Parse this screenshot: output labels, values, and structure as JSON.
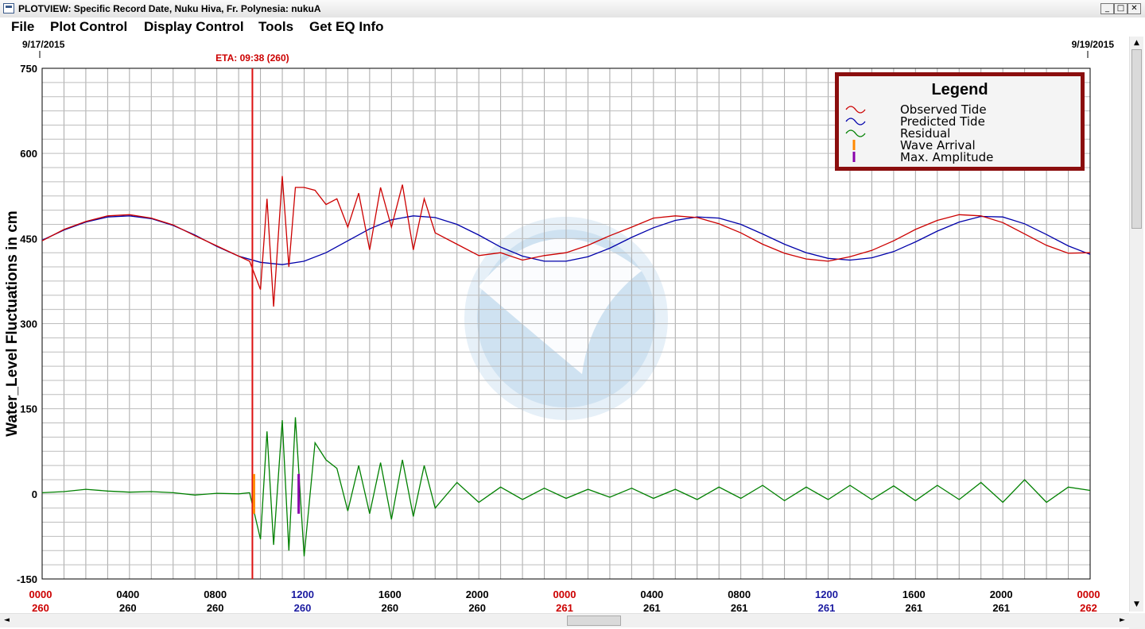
{
  "window": {
    "title": "PLOTVIEW: Specific Record Date, Nuku Hiva, Fr. Polynesia: nukuA",
    "minimize_glyph": "_",
    "maximize_glyph": "□",
    "close_glyph": "✕",
    "icon": "app-icon"
  },
  "menu": {
    "items": [
      "File",
      "Plot Control",
      "Display Control",
      "Tools",
      "Get EQ Info"
    ]
  },
  "scrollbars": {
    "up_glyph": "▲",
    "down_glyph": "▼",
    "left_glyph": "◄",
    "right_glyph": "►"
  },
  "chart_data": {
    "type": "line",
    "date_start": "9/17/2015",
    "date_end": "9/19/2015",
    "ylabel": "Water_Level Fluctuations in cm",
    "ylim": [
      -150,
      750
    ],
    "yticks": [
      750,
      600,
      450,
      300,
      150,
      0,
      -150
    ],
    "xlim_hours": [
      0,
      48
    ],
    "eta_label": "ETA: 09:38 (260)",
    "eta_hour": 9.63,
    "grid": true,
    "background_emblem": "noaa-seal-watermark",
    "x_tick_hours": [
      0,
      4,
      8,
      12,
      16,
      20,
      24,
      28,
      32,
      36,
      40,
      44,
      48
    ],
    "x_tick_times": [
      "0000",
      "0400",
      "0800",
      "1200",
      "1600",
      "2000",
      "0000",
      "0400",
      "0800",
      "1200",
      "1600",
      "2000",
      "0000"
    ],
    "x_tick_days": [
      "260",
      "260",
      "260",
      "260",
      "260",
      "260",
      "261",
      "261",
      "261",
      "261",
      "261",
      "261",
      "262"
    ],
    "x_tick_colors": [
      "#cc0000",
      "#000000",
      "#000000",
      "#1a1aa0",
      "#000000",
      "#000000",
      "#cc0000",
      "#000000",
      "#000000",
      "#1a1aa0",
      "#000000",
      "#000000",
      "#cc0000"
    ],
    "legend": {
      "title": "Legend",
      "position": "top-right",
      "entries": [
        {
          "label": "Observed Tide",
          "color": "#cc0000",
          "symbol": "wave"
        },
        {
          "label": "Predicted Tide",
          "color": "#0000aa",
          "symbol": "wave"
        },
        {
          "label": "Residual",
          "color": "#008000",
          "symbol": "wave"
        },
        {
          "label": "Wave Arrival",
          "color": "#ff8800",
          "symbol": "bar"
        },
        {
          "label": "Max. Amplitude",
          "color": "#8800aa",
          "symbol": "bar"
        }
      ]
    },
    "series": [
      {
        "name": "Predicted Tide",
        "color": "#0000aa",
        "x": [
          0,
          1,
          2,
          3,
          4,
          5,
          6,
          7,
          8,
          9,
          10,
          11,
          12,
          13,
          14,
          15,
          16,
          17,
          18,
          19,
          20,
          21,
          22,
          23,
          24,
          25,
          26,
          27,
          28,
          29,
          30,
          31,
          32,
          33,
          34,
          35,
          36,
          37,
          38,
          39,
          40,
          41,
          42,
          43,
          44,
          45,
          46,
          47,
          48
        ],
        "values": [
          447,
          465,
          479,
          488,
          490,
          485,
          473,
          456,
          436,
          419,
          408,
          404,
          410,
          425,
          446,
          467,
          483,
          490,
          487,
          475,
          456,
          435,
          419,
          410,
          410,
          418,
          433,
          452,
          469,
          482,
          488,
          486,
          475,
          458,
          440,
          425,
          415,
          412,
          416,
          427,
          444,
          463,
          479,
          489,
          488,
          476,
          457,
          437,
          422
        ]
      },
      {
        "name": "Observed Tide",
        "color": "#cc0000",
        "x": [
          0,
          1,
          2,
          3,
          4,
          5,
          6,
          7,
          8,
          9,
          9.5,
          10,
          10.3,
          10.6,
          11,
          11.3,
          11.6,
          12,
          12.5,
          13,
          13.5,
          14,
          14.5,
          15,
          15.5,
          16,
          16.5,
          17,
          17.5,
          18,
          19,
          20,
          21,
          22,
          23,
          24,
          25,
          26,
          27,
          28,
          29,
          30,
          31,
          32,
          33,
          34,
          35,
          36,
          37,
          38,
          39,
          40,
          41,
          42,
          43,
          44,
          45,
          46,
          47,
          48
        ],
        "values": [
          446,
          466,
          480,
          490,
          492,
          486,
          474,
          455,
          437,
          419,
          410,
          360,
          520,
          330,
          560,
          400,
          540,
          540,
          535,
          510,
          520,
          470,
          530,
          430,
          540,
          470,
          545,
          430,
          520,
          460,
          440,
          420,
          425,
          412,
          420,
          425,
          438,
          455,
          470,
          486,
          490,
          487,
          476,
          460,
          440,
          424,
          414,
          410,
          418,
          429,
          446,
          466,
          482,
          492,
          490,
          478,
          458,
          438,
          424,
          425
        ]
      },
      {
        "name": "Residual",
        "color": "#008000",
        "x": [
          0,
          1,
          2,
          3,
          4,
          5,
          6,
          7,
          8,
          9,
          9.5,
          10,
          10.3,
          10.6,
          11,
          11.3,
          11.6,
          12,
          12.5,
          13,
          13.5,
          14,
          14.5,
          15,
          15.5,
          16,
          16.5,
          17,
          17.5,
          18,
          19,
          20,
          21,
          22,
          23,
          24,
          25,
          26,
          27,
          28,
          29,
          30,
          31,
          32,
          33,
          34,
          35,
          36,
          37,
          38,
          39,
          40,
          41,
          42,
          43,
          44,
          45,
          46,
          47,
          48
        ],
        "values": [
          2,
          4,
          8,
          5,
          3,
          4,
          2,
          -2,
          1,
          0,
          2,
          -80,
          110,
          -90,
          130,
          -100,
          135,
          -110,
          90,
          60,
          45,
          -30,
          50,
          -35,
          55,
          -45,
          60,
          -40,
          50,
          -25,
          20,
          -15,
          12,
          -10,
          10,
          -8,
          8,
          -6,
          10,
          -8,
          8,
          -10,
          12,
          -8,
          15,
          -12,
          12,
          -10,
          15,
          -10,
          14,
          -12,
          15,
          -10,
          20,
          -15,
          25,
          -15,
          12,
          6
        ]
      }
    ],
    "wave_arrival_hour": 9.63,
    "max_amplitude_hour": 11.75
  }
}
